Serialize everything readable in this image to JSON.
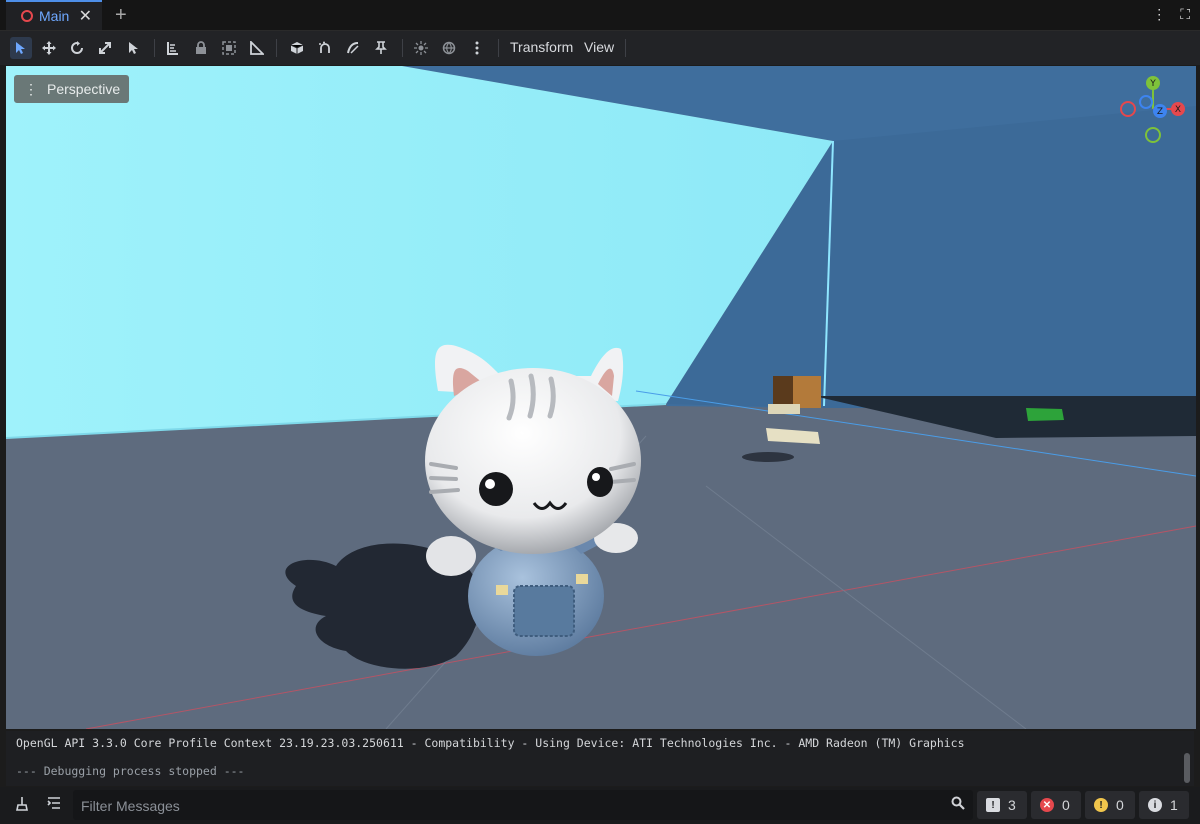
{
  "tabs": [
    {
      "label": "Main",
      "close_glyph": "✕"
    }
  ],
  "tab_add_glyph": "+",
  "tab_menu_glyph": "⋮",
  "tab_fullscreen_glyph": "⛶",
  "toolbar": {
    "menus": {
      "transform": "Transform",
      "view": "View"
    },
    "icons": [
      "select-mode-icon",
      "move-mode-icon",
      "rotate-mode-icon",
      "scale-mode-icon",
      "list-select-icon",
      "ruler-icon",
      "lock-icon",
      "group-icon",
      "snap-icon",
      "local-space-icon",
      "smart-snap-icon",
      "bezier-icon",
      "grid-icon",
      "pin-icon",
      "sun-icon",
      "environment-icon",
      "more-icon"
    ]
  },
  "viewport": {
    "mode_label": "Perspective",
    "kebab_glyph": "⋮",
    "gizmo": {
      "y": "Y",
      "z": "Z",
      "x": "X",
      "colors": {
        "x": "#e5484d",
        "y": "#7ec23a",
        "z": "#3d84f0"
      }
    },
    "colors": {
      "sky_wall": "#a3f4fb",
      "back_wall": "#3d6c9c",
      "floor": "#5d6a7d"
    }
  },
  "console": {
    "line1": "OpenGL API 3.3.0 Core Profile Context 23.19.23.03.250611 - Compatibility - Using Device: ATI Technologies Inc. - AMD Radeon (TM) Graphics",
    "line2": "--- Debugging process stopped ---"
  },
  "bottom": {
    "filter_placeholder": "Filter Messages",
    "counts": {
      "errors": "3",
      "error_x": "0",
      "warnings": "0",
      "info": "1"
    },
    "glyphs": {
      "error": "!",
      "error_x": "✕",
      "warning": "!",
      "info": "i"
    }
  }
}
